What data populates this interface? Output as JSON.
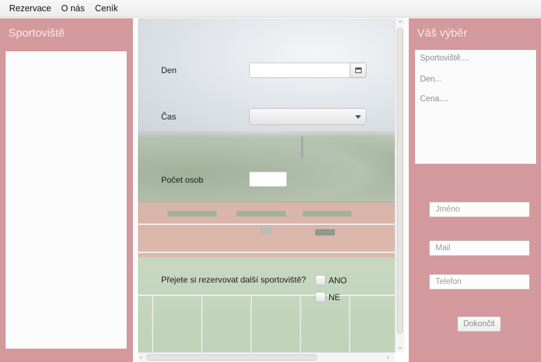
{
  "menu": {
    "items": [
      {
        "label": "Rezervace"
      },
      {
        "label": "O nás"
      },
      {
        "label": "Ceník"
      }
    ]
  },
  "left_panel": {
    "title": "Sportoviště",
    "items": []
  },
  "form": {
    "day_label": "Den",
    "day_value": "",
    "time_label": "Čas",
    "time_selected": "",
    "persons_label": "Počet osob",
    "persons_value": "",
    "another_question": "Přejete si rezervovat další sportoviště?",
    "yes_label": "ANO",
    "no_label": "NE",
    "yes_checked": false,
    "no_checked": false
  },
  "right_panel": {
    "title": "Váš výběr",
    "summary": [
      "Sportoviště....",
      "Den...",
      "Cena...."
    ],
    "name_placeholder": "Jméno",
    "mail_placeholder": "Mail",
    "phone_placeholder": "Telefon",
    "finish_label": "Dokončit"
  },
  "icons": {
    "calendar": "calendar-icon",
    "dropdown": "chevron-down-icon",
    "scroll_up": "arrow-up-icon",
    "scroll_down": "arrow-down-icon",
    "scroll_left": "arrow-left-icon",
    "scroll_right": "arrow-right-icon"
  },
  "colors": {
    "side_panel": "#d4999c",
    "panel_title": "#f6eaea"
  }
}
